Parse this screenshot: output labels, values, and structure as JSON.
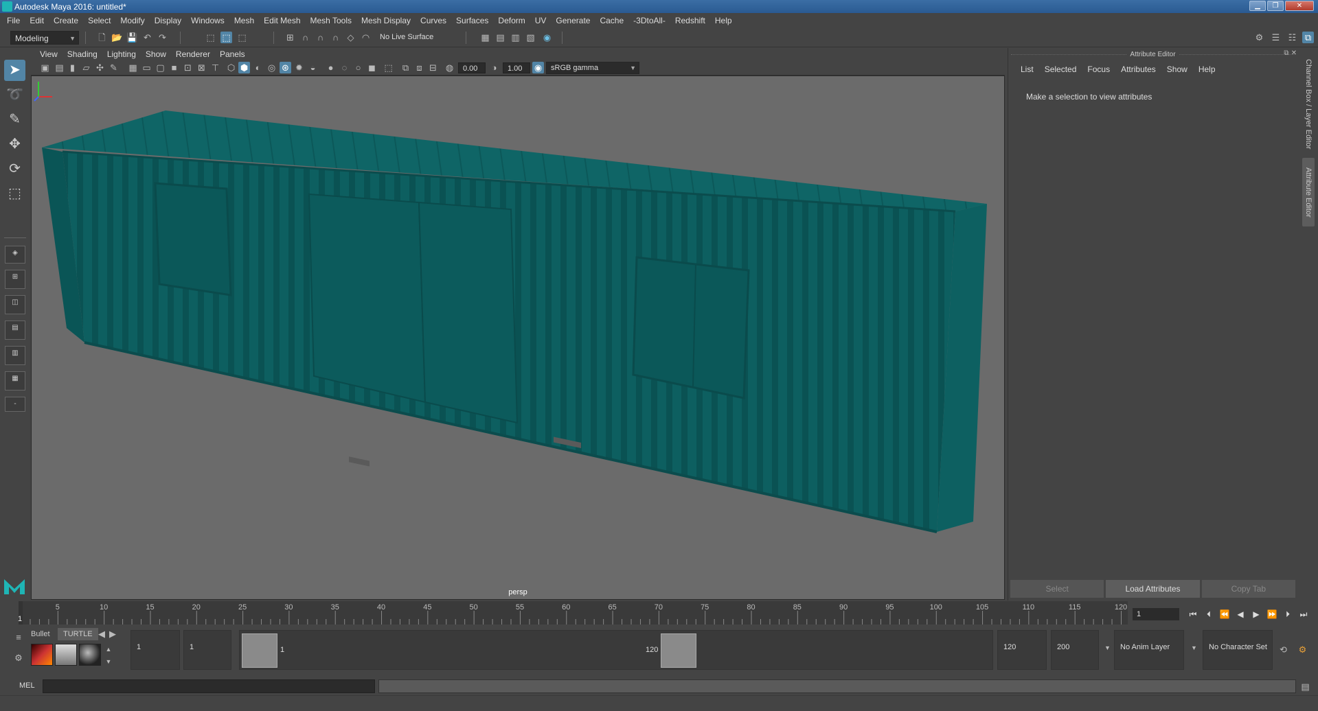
{
  "window": {
    "title": "Autodesk Maya 2016: untitled*"
  },
  "menu": [
    "File",
    "Edit",
    "Create",
    "Select",
    "Modify",
    "Display",
    "Windows",
    "Mesh",
    "Edit Mesh",
    "Mesh Tools",
    "Mesh Display",
    "Curves",
    "Surfaces",
    "Deform",
    "UV",
    "Generate",
    "Cache",
    "-3DtoAll-",
    "Redshift",
    "Help"
  ],
  "shelf": {
    "mode": "Modeling",
    "live_surface": "No Live Surface"
  },
  "viewport": {
    "menu": [
      "View",
      "Shading",
      "Lighting",
      "Show",
      "Renderer",
      "Panels"
    ],
    "exposure": "0.00",
    "gamma": "1.00",
    "color_space": "sRGB gamma",
    "camera_label": "persp",
    "model_color": "#0d5f60"
  },
  "attribute_editor": {
    "title": "Attribute Editor",
    "menu": [
      "List",
      "Selected",
      "Focus",
      "Attributes",
      "Show",
      "Help"
    ],
    "message": "Make a selection to view attributes",
    "buttons": {
      "select": "Select",
      "load": "Load Attributes",
      "copy": "Copy Tab"
    },
    "side_tabs": {
      "channel_box": "Channel Box / Layer Editor",
      "attribute_editor": "Attribute Editor"
    }
  },
  "timeline": {
    "ticks": [
      1,
      5,
      10,
      15,
      20,
      25,
      30,
      35,
      40,
      45,
      50,
      55,
      60,
      65,
      70,
      75,
      80,
      85,
      90,
      95,
      100,
      105,
      110,
      115,
      120
    ],
    "current_frame": "1",
    "marker_label": "1"
  },
  "range": {
    "shelf_tabs": [
      "Bullet",
      "TURTLE"
    ],
    "start": "1",
    "anim_start": "1",
    "slider_start": "1",
    "slider_end": "120",
    "anim_end": "120",
    "end": "200",
    "anim_layer": "No Anim Layer",
    "character_set": "No Character Set"
  },
  "command": {
    "label": "MEL"
  }
}
